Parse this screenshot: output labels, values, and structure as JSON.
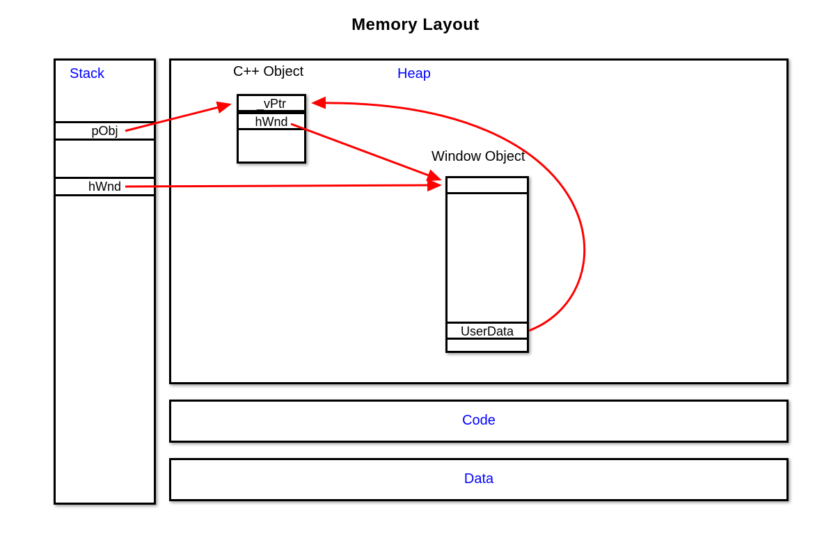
{
  "title": "Memory Layout",
  "segments": {
    "stack": "Stack",
    "heap": "Heap",
    "code": "Code",
    "data": "Data"
  },
  "objects": {
    "cpp": "C++ Object",
    "window": "Window Object"
  },
  "fields": {
    "stack_pObj": "pObj",
    "stack_hWnd": "hWnd",
    "cpp_vptr": "_vPtr",
    "cpp_hwnd": "hWnd",
    "win_userdata": "UserData"
  }
}
